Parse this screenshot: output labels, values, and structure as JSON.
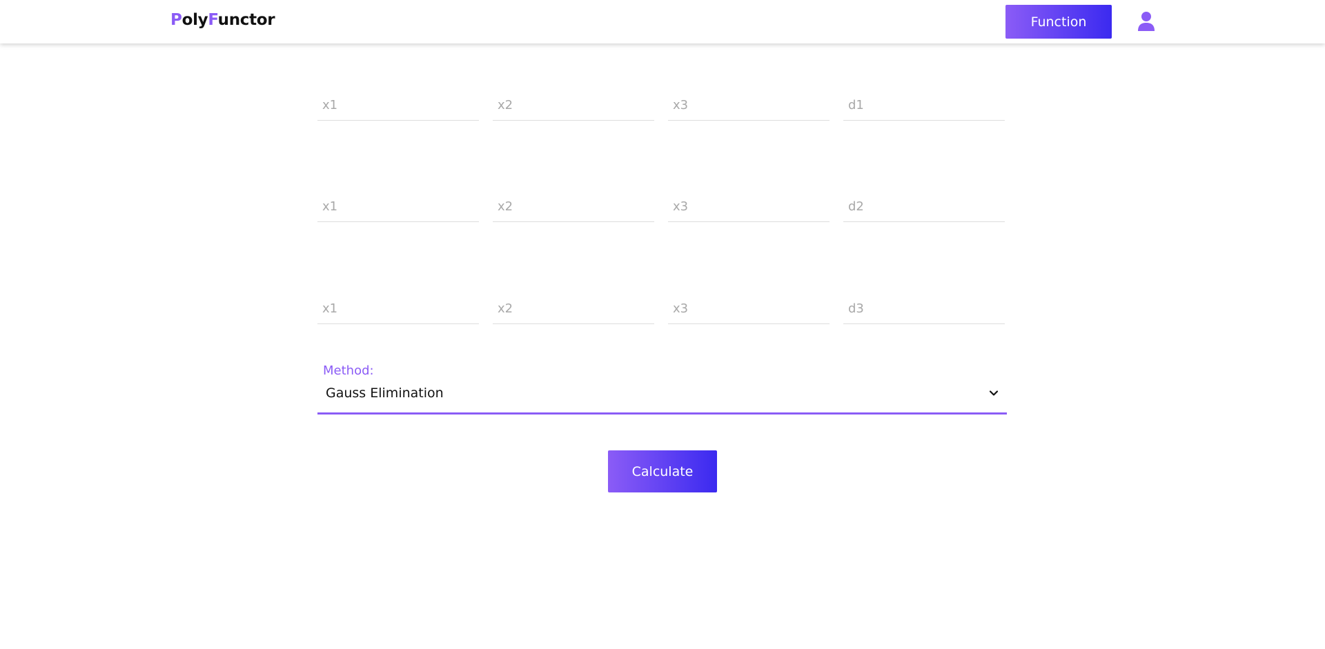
{
  "nav": {
    "brand_p": "P",
    "brand_oly": "oly",
    "brand_f": "F",
    "brand_unctor": "unctor",
    "function_button": "Function",
    "user_icon": "user-icon"
  },
  "equations": [
    {
      "x1": "x1",
      "x2": "x2",
      "x3": "x3",
      "d": "d1"
    },
    {
      "x1": "x1",
      "x2": "x2",
      "x3": "x3",
      "d": "d2"
    },
    {
      "x1": "x1",
      "x2": "x2",
      "x3": "x3",
      "d": "d3"
    }
  ],
  "method": {
    "label": "Method:",
    "selected": "Gauss Elimination"
  },
  "calculate_button": "Calculate",
  "colors": {
    "accent": "#8b5cf6",
    "gradient_end": "#3b2af0"
  }
}
